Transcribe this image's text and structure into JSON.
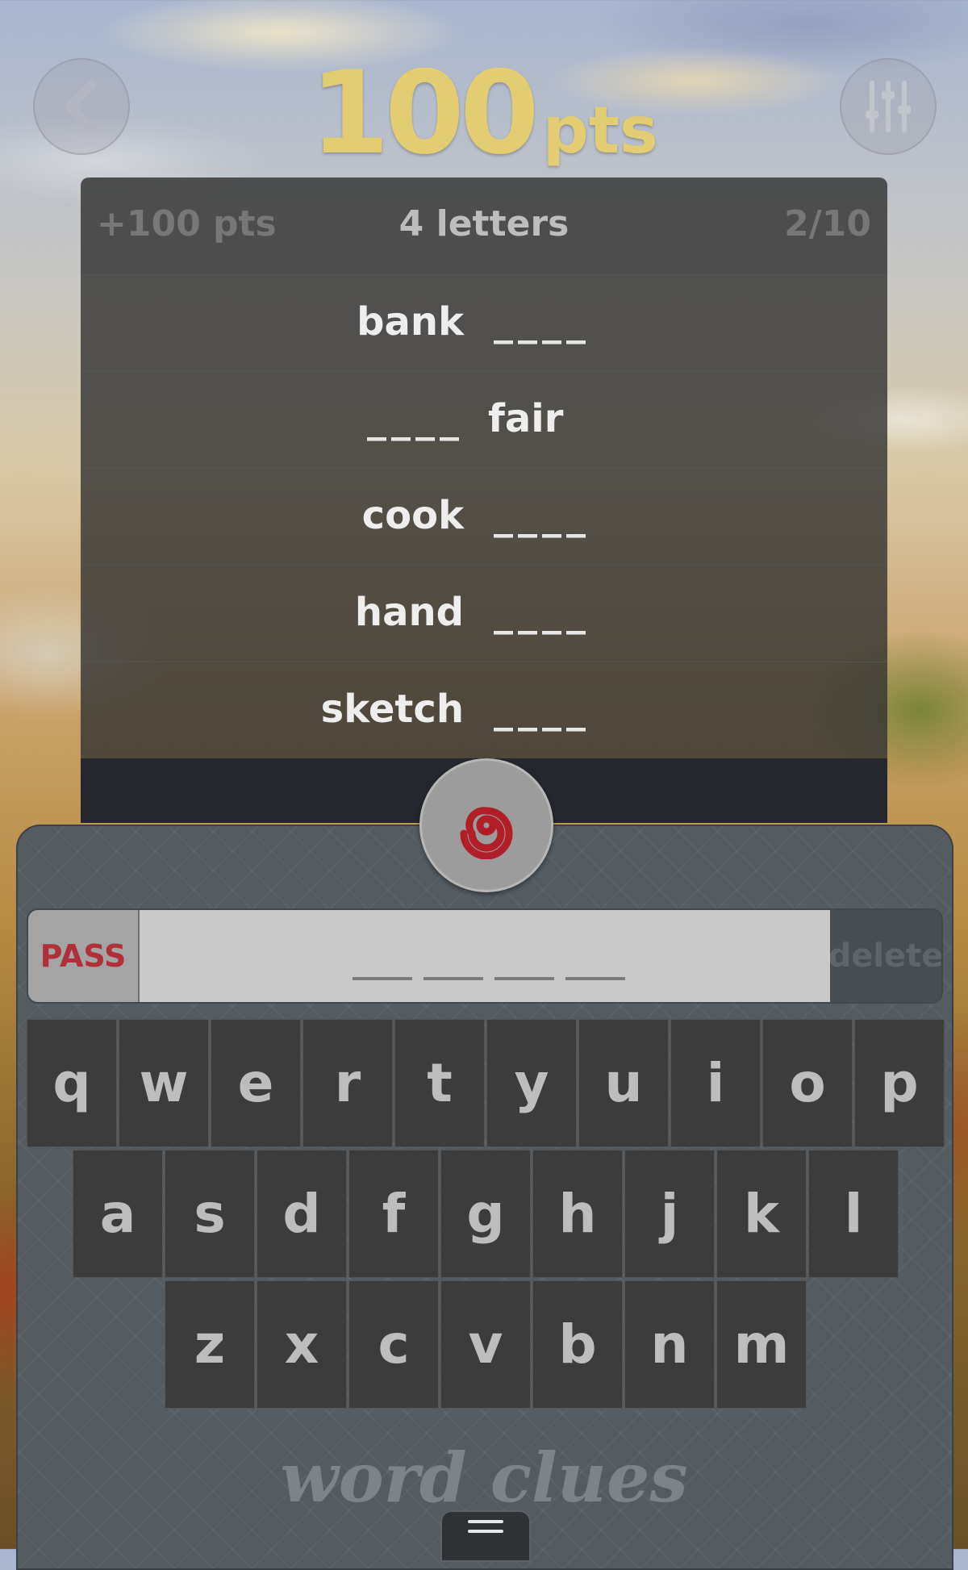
{
  "header": {
    "score_value": "100",
    "score_unit": "pts"
  },
  "panel": {
    "bonus": "+100 pts",
    "letters": "4 letters",
    "progress": "2/10",
    "clues": [
      {
        "word": "bank",
        "blank": "____",
        "position": "before"
      },
      {
        "word": "fair",
        "blank": "____",
        "position": "after"
      },
      {
        "word": "cook",
        "blank": "____",
        "position": "before"
      },
      {
        "word": "hand",
        "blank": "____",
        "position": "before"
      },
      {
        "word": "sketch",
        "blank": "____",
        "position": "before"
      }
    ]
  },
  "input": {
    "pass_label": "PASS",
    "delete_label": "delete",
    "slot_count": 4
  },
  "keyboard": {
    "rows": [
      [
        "q",
        "w",
        "e",
        "r",
        "t",
        "y",
        "u",
        "i",
        "o",
        "p"
      ],
      [
        "a",
        "s",
        "d",
        "f",
        "g",
        "h",
        "j",
        "k",
        "l"
      ],
      [
        "z",
        "x",
        "c",
        "v",
        "b",
        "n",
        "m"
      ]
    ]
  },
  "brand": "word clues",
  "icons": {
    "back": "chevron-left-icon",
    "settings": "sliders-icon",
    "spin": "swirl-icon",
    "menu": "hamburger-icon"
  },
  "colors": {
    "score": "#e2cd72",
    "pass": "#b0303a",
    "swirl": "#b01f28"
  }
}
